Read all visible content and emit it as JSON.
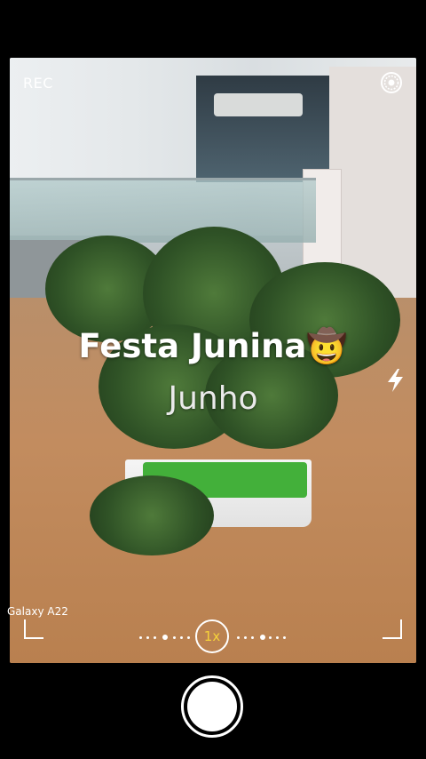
{
  "status": {
    "rec_label": "REC"
  },
  "overlay": {
    "title": "Festa Junina🤠",
    "subtitle": "Junho"
  },
  "device": {
    "label": "Galaxy A22"
  },
  "zoom": {
    "label": "1x"
  },
  "icons": {
    "settings": "camera-settings-icon",
    "flash": "flash-icon"
  },
  "colors": {
    "zoom_accent": "#f6d23a",
    "background": "#000000"
  }
}
